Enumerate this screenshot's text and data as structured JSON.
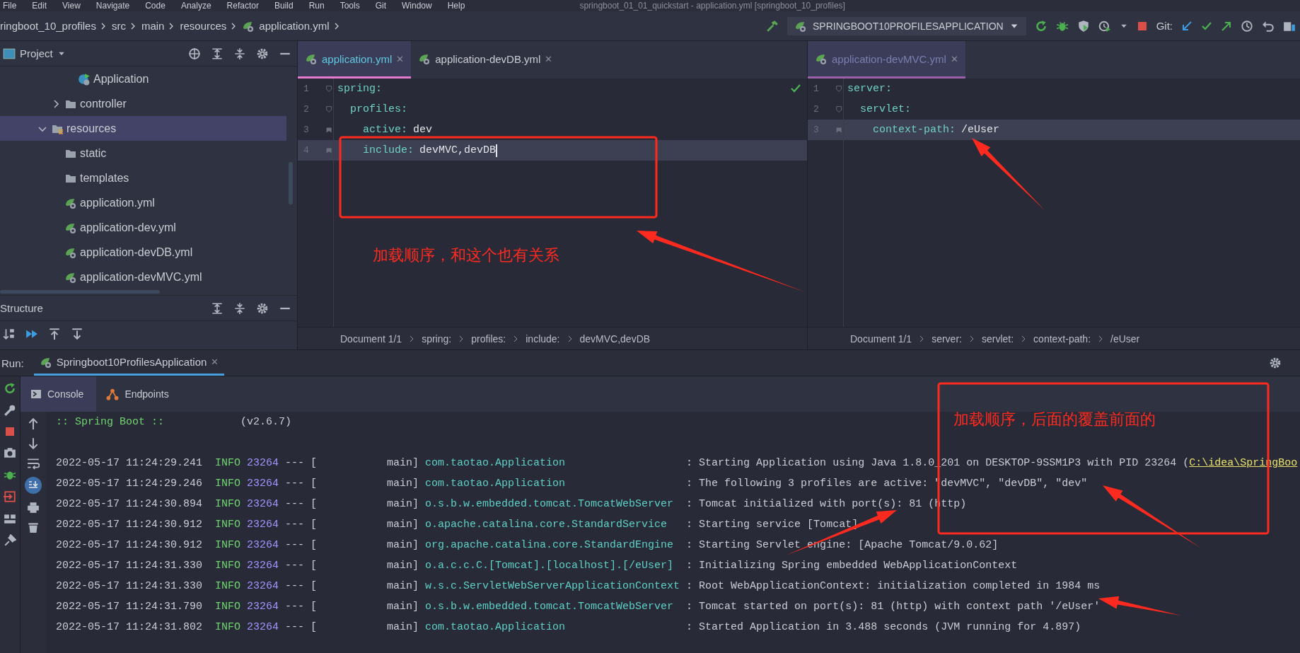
{
  "menu_bar": {
    "items": [
      "File",
      "Edit",
      "View",
      "Navigate",
      "Code",
      "Analyze",
      "Refactor",
      "Build",
      "Run",
      "Tools",
      "Git",
      "Window",
      "Help"
    ],
    "title": "springboot_01_01_quickstart - application.yml [springboot_10_profiles]"
  },
  "navigation_bar": {
    "breadcrumbs": [
      "ringboot_10_profiles",
      "src",
      "main",
      "resources",
      "application.yml"
    ],
    "run_config": "SPRINGBOOT10PROFILESAPPLICATION",
    "git_label": "Git:"
  },
  "project_panel": {
    "title": "Project",
    "tree": [
      {
        "children": [
          {
            "children": [
              {
                "label": "Application",
                "kind": "spring-class",
                "selected": false
              }
            ]
          },
          {
            "label": "controller",
            "kind": "folder",
            "expanded": false,
            "selected": false
          }
        ]
      },
      {
        "label": "resources",
        "kind": "resource-folder",
        "expanded": true,
        "selected": true,
        "children": [
          {
            "label": "static",
            "kind": "folder",
            "selected": false
          },
          {
            "label": "templates",
            "kind": "folder",
            "selected": false
          },
          {
            "label": "application.yml",
            "kind": "yaml",
            "selected": false
          },
          {
            "label": "application-dev.yml",
            "kind": "yaml",
            "selected": false
          },
          {
            "label": "application-devDB.yml",
            "kind": "yaml",
            "selected": false
          },
          {
            "label": "application-devMVC.yml",
            "kind": "yaml",
            "selected": false
          }
        ]
      }
    ]
  },
  "structure_panel": {
    "title": "Structure"
  },
  "editors": [
    {
      "tabs": [
        {
          "label": "application.yml",
          "close": "✕",
          "selected": true
        },
        {
          "label": "application-devDB.yml",
          "close": "✕",
          "selected": false
        }
      ],
      "lines": [
        {
          "number": "1",
          "key": "spring:",
          "current": false,
          "caret": false
        },
        {
          "number": "2",
          "key": "  profiles:",
          "current": false,
          "caret": false
        },
        {
          "number": "3",
          "key": "    active:",
          "value": "dev",
          "current": false,
          "caret": false
        },
        {
          "number": "4",
          "key": "    include:",
          "value": "devMVC,devDB",
          "current": true,
          "caret": true
        }
      ],
      "ok": true,
      "breadcrumbs": [
        "Document 1/1",
        "spring:",
        "profiles:",
        "include:",
        "devMVC,devDB"
      ]
    },
    {
      "tabs": [
        {
          "label": "application-devMVC.yml",
          "close": "✕",
          "selected": false
        }
      ],
      "lines": [
        {
          "number": "1",
          "key": "server:",
          "current": false,
          "caret": false
        },
        {
          "number": "2",
          "key": "  servlet:",
          "current": false,
          "caret": false
        },
        {
          "number": "3",
          "key": "    context-path:",
          "value": "/eUser",
          "current": true,
          "caret": false
        }
      ],
      "ok": false,
      "breadcrumbs": [
        "Document 1/1",
        "server:",
        "servlet:",
        "context-path:",
        "/eUser"
      ]
    }
  ],
  "run_panel": {
    "label": "Run:",
    "tabs": [
      {
        "label": "Springboot10ProfilesApplication",
        "close": "✕",
        "selected": true
      }
    ],
    "console_tabs": [
      {
        "label": "Console",
        "kind": "console",
        "selected": true
      },
      {
        "label": "Endpoints",
        "kind": "endpoints",
        "selected": false
      }
    ],
    "banner": {
      "name": ":: Spring Boot ::",
      "version": "(v2.6.7)"
    },
    "logs": [
      {
        "time": "2022-05-17 11:24:29.241",
        "level": "INFO",
        "pid": "23264",
        "sep": "---",
        "thread": "[           main]",
        "logger": "com.taotao.Application",
        "message": ": Starting Application using Java 1.8.0_201 on DESKTOP-9SSM1P3 with PID 23264 (",
        "link": "C:\\idea\\SpringBoo"
      },
      {
        "time": "2022-05-17 11:24:29.246",
        "level": "INFO",
        "pid": "23264",
        "sep": "---",
        "thread": "[           main]",
        "logger": "com.taotao.Application",
        "message": ": The following 3 profiles are active: \"devMVC\", \"devDB\", \"dev\""
      },
      {
        "time": "2022-05-17 11:24:30.894",
        "level": "INFO",
        "pid": "23264",
        "sep": "---",
        "thread": "[           main]",
        "logger": "o.s.b.w.embedded.tomcat.TomcatWebServer",
        "message": ": Tomcat initialized with port(s): 81 (http)"
      },
      {
        "time": "2022-05-17 11:24:30.912",
        "level": "INFO",
        "pid": "23264",
        "sep": "---",
        "thread": "[           main]",
        "logger": "o.apache.catalina.core.StandardService",
        "message": ": Starting service [Tomcat]"
      },
      {
        "time": "2022-05-17 11:24:30.912",
        "level": "INFO",
        "pid": "23264",
        "sep": "---",
        "thread": "[           main]",
        "logger": "org.apache.catalina.core.StandardEngine",
        "message": ": Starting Servlet engine: [Apache Tomcat/9.0.62]"
      },
      {
        "time": "2022-05-17 11:24:31.330",
        "level": "INFO",
        "pid": "23264",
        "sep": "---",
        "thread": "[           main]",
        "logger": "o.a.c.c.C.[Tomcat].[localhost].[/eUser]",
        "message": ": Initializing Spring embedded WebApplicationContext"
      },
      {
        "time": "2022-05-17 11:24:31.330",
        "level": "INFO",
        "pid": "23264",
        "sep": "---",
        "thread": "[           main]",
        "logger": "w.s.c.ServletWebServerApplicationContext",
        "message": ": Root WebApplicationContext: initialization completed in 1984 ms"
      },
      {
        "time": "2022-05-17 11:24:31.790",
        "level": "INFO",
        "pid": "23264",
        "sep": "---",
        "thread": "[           main]",
        "logger": "o.s.b.w.embedded.tomcat.TomcatWebServer",
        "message": ": Tomcat started on port(s): 81 (http) with context path '/eUser'"
      },
      {
        "time": "2022-05-17 11:24:31.802",
        "level": "INFO",
        "pid": "23264",
        "sep": "---",
        "thread": "[           main]",
        "logger": "com.taotao.Application",
        "message": ": Started Application in 3.488 seconds (JVM running for 4.897)"
      }
    ]
  },
  "annotations": [
    {
      "text": "加载顺序，和这个也有关系"
    },
    {
      "text": "加载顺序，后面的覆盖前面的"
    }
  ]
}
